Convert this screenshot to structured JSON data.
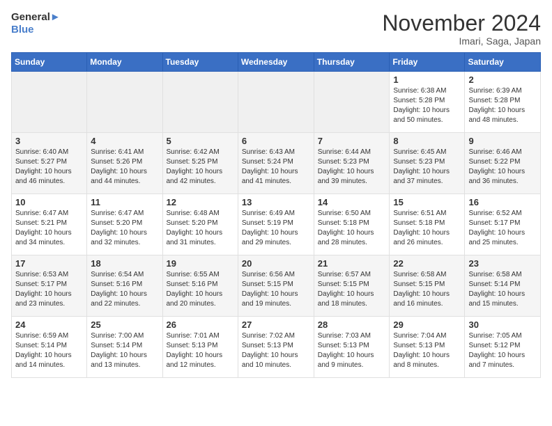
{
  "logo": {
    "line1": "General",
    "line2": "Blue"
  },
  "title": "November 2024",
  "subtitle": "Imari, Saga, Japan",
  "weekdays": [
    "Sunday",
    "Monday",
    "Tuesday",
    "Wednesday",
    "Thursday",
    "Friday",
    "Saturday"
  ],
  "weeks": [
    [
      {
        "day": "",
        "info": ""
      },
      {
        "day": "",
        "info": ""
      },
      {
        "day": "",
        "info": ""
      },
      {
        "day": "",
        "info": ""
      },
      {
        "day": "",
        "info": ""
      },
      {
        "day": "1",
        "info": "Sunrise: 6:38 AM\nSunset: 5:28 PM\nDaylight: 10 hours\nand 50 minutes."
      },
      {
        "day": "2",
        "info": "Sunrise: 6:39 AM\nSunset: 5:28 PM\nDaylight: 10 hours\nand 48 minutes."
      }
    ],
    [
      {
        "day": "3",
        "info": "Sunrise: 6:40 AM\nSunset: 5:27 PM\nDaylight: 10 hours\nand 46 minutes."
      },
      {
        "day": "4",
        "info": "Sunrise: 6:41 AM\nSunset: 5:26 PM\nDaylight: 10 hours\nand 44 minutes."
      },
      {
        "day": "5",
        "info": "Sunrise: 6:42 AM\nSunset: 5:25 PM\nDaylight: 10 hours\nand 42 minutes."
      },
      {
        "day": "6",
        "info": "Sunrise: 6:43 AM\nSunset: 5:24 PM\nDaylight: 10 hours\nand 41 minutes."
      },
      {
        "day": "7",
        "info": "Sunrise: 6:44 AM\nSunset: 5:23 PM\nDaylight: 10 hours\nand 39 minutes."
      },
      {
        "day": "8",
        "info": "Sunrise: 6:45 AM\nSunset: 5:23 PM\nDaylight: 10 hours\nand 37 minutes."
      },
      {
        "day": "9",
        "info": "Sunrise: 6:46 AM\nSunset: 5:22 PM\nDaylight: 10 hours\nand 36 minutes."
      }
    ],
    [
      {
        "day": "10",
        "info": "Sunrise: 6:47 AM\nSunset: 5:21 PM\nDaylight: 10 hours\nand 34 minutes."
      },
      {
        "day": "11",
        "info": "Sunrise: 6:47 AM\nSunset: 5:20 PM\nDaylight: 10 hours\nand 32 minutes."
      },
      {
        "day": "12",
        "info": "Sunrise: 6:48 AM\nSunset: 5:20 PM\nDaylight: 10 hours\nand 31 minutes."
      },
      {
        "day": "13",
        "info": "Sunrise: 6:49 AM\nSunset: 5:19 PM\nDaylight: 10 hours\nand 29 minutes."
      },
      {
        "day": "14",
        "info": "Sunrise: 6:50 AM\nSunset: 5:18 PM\nDaylight: 10 hours\nand 28 minutes."
      },
      {
        "day": "15",
        "info": "Sunrise: 6:51 AM\nSunset: 5:18 PM\nDaylight: 10 hours\nand 26 minutes."
      },
      {
        "day": "16",
        "info": "Sunrise: 6:52 AM\nSunset: 5:17 PM\nDaylight: 10 hours\nand 25 minutes."
      }
    ],
    [
      {
        "day": "17",
        "info": "Sunrise: 6:53 AM\nSunset: 5:17 PM\nDaylight: 10 hours\nand 23 minutes."
      },
      {
        "day": "18",
        "info": "Sunrise: 6:54 AM\nSunset: 5:16 PM\nDaylight: 10 hours\nand 22 minutes."
      },
      {
        "day": "19",
        "info": "Sunrise: 6:55 AM\nSunset: 5:16 PM\nDaylight: 10 hours\nand 20 minutes."
      },
      {
        "day": "20",
        "info": "Sunrise: 6:56 AM\nSunset: 5:15 PM\nDaylight: 10 hours\nand 19 minutes."
      },
      {
        "day": "21",
        "info": "Sunrise: 6:57 AM\nSunset: 5:15 PM\nDaylight: 10 hours\nand 18 minutes."
      },
      {
        "day": "22",
        "info": "Sunrise: 6:58 AM\nSunset: 5:15 PM\nDaylight: 10 hours\nand 16 minutes."
      },
      {
        "day": "23",
        "info": "Sunrise: 6:58 AM\nSunset: 5:14 PM\nDaylight: 10 hours\nand 15 minutes."
      }
    ],
    [
      {
        "day": "24",
        "info": "Sunrise: 6:59 AM\nSunset: 5:14 PM\nDaylight: 10 hours\nand 14 minutes."
      },
      {
        "day": "25",
        "info": "Sunrise: 7:00 AM\nSunset: 5:14 PM\nDaylight: 10 hours\nand 13 minutes."
      },
      {
        "day": "26",
        "info": "Sunrise: 7:01 AM\nSunset: 5:13 PM\nDaylight: 10 hours\nand 12 minutes."
      },
      {
        "day": "27",
        "info": "Sunrise: 7:02 AM\nSunset: 5:13 PM\nDaylight: 10 hours\nand 10 minutes."
      },
      {
        "day": "28",
        "info": "Sunrise: 7:03 AM\nSunset: 5:13 PM\nDaylight: 10 hours\nand 9 minutes."
      },
      {
        "day": "29",
        "info": "Sunrise: 7:04 AM\nSunset: 5:13 PM\nDaylight: 10 hours\nand 8 minutes."
      },
      {
        "day": "30",
        "info": "Sunrise: 7:05 AM\nSunset: 5:12 PM\nDaylight: 10 hours\nand 7 minutes."
      }
    ]
  ]
}
